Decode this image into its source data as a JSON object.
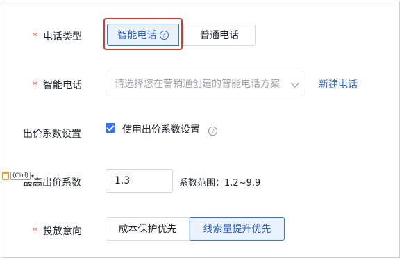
{
  "form": {
    "phone_type": {
      "required_mark": "*",
      "label": "电话类型",
      "options": [
        "智能电话",
        "普通电话"
      ],
      "selected": "智能电话",
      "help_icon": "question-circle-icon"
    },
    "smart_phone": {
      "required_mark": "*",
      "label": "智能电话",
      "placeholder": "请选择您在营销通创建的智能电话方案",
      "dropdown_icon": "chevron-down-icon",
      "new_link": "新建电话"
    },
    "bid_setting": {
      "label": "出价系数设置",
      "checkbox_label": "使用出价系数设置",
      "checked": true,
      "help_icon": "question-circle-icon"
    },
    "max_bid": {
      "label": "最高出价系数",
      "value": "1.3",
      "range_text": "系数范围：1.2~9.9"
    },
    "intent": {
      "required_mark": "*",
      "label": "投放意向",
      "options": [
        "成本保护优先",
        "线索量提升优先"
      ],
      "selected": "线索量提升优先"
    }
  },
  "paste_popup": {
    "icon": "paste-icon",
    "label": "(Ctrl)"
  },
  "colors": {
    "accent": "#3370ff",
    "required": "#f04a3e",
    "highlight_box": "#e8322a"
  }
}
